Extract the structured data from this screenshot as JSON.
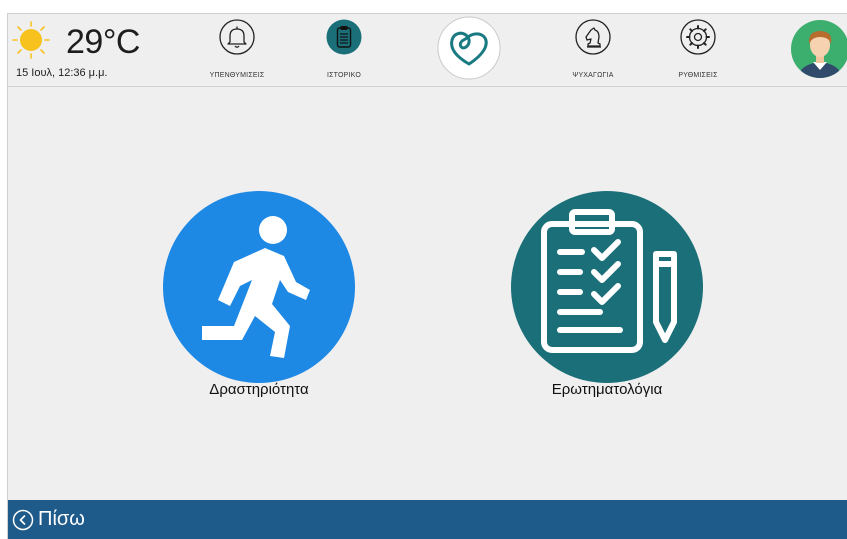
{
  "header": {
    "weather": {
      "icon": "sun-icon",
      "temperature": "29°C",
      "datetime": "15 Ιουλ, 12:36 μ.μ."
    },
    "nav": [
      {
        "icon": "bell-icon",
        "label": "ΥΠΕΝΘΥΜΙΣΕΙΣ"
      },
      {
        "icon": "clipboard-icon",
        "label": "ΙΣΤΟΡΙΚΟ"
      },
      {
        "icon": "heart-logo-icon",
        "label": ""
      },
      {
        "icon": "chess-knight-icon",
        "label": "ΨΥΧΑΓΩΓΙΑ"
      },
      {
        "icon": "gear-icon",
        "label": "ΡΥΘΜΙΣΕΙΣ"
      },
      {
        "icon": "avatar",
        "label": ""
      }
    ]
  },
  "main": {
    "items": [
      {
        "icon": "running-person-icon",
        "label": "Δραστηριότητα"
      },
      {
        "icon": "checklist-clipboard-icon",
        "label": "Ερωτηματολόγια"
      }
    ]
  },
  "footer": {
    "back_label": "Πίσω",
    "back_icon": "chevron-left-icon"
  },
  "colors": {
    "background": "#efefef",
    "footer": "#1e5a8a",
    "activity": "#1e88e5",
    "questionnaire": "#1a6f78",
    "history_active": "#1a6f78",
    "avatar_bg": "#3cae6e",
    "sun": "#f7c21e"
  }
}
